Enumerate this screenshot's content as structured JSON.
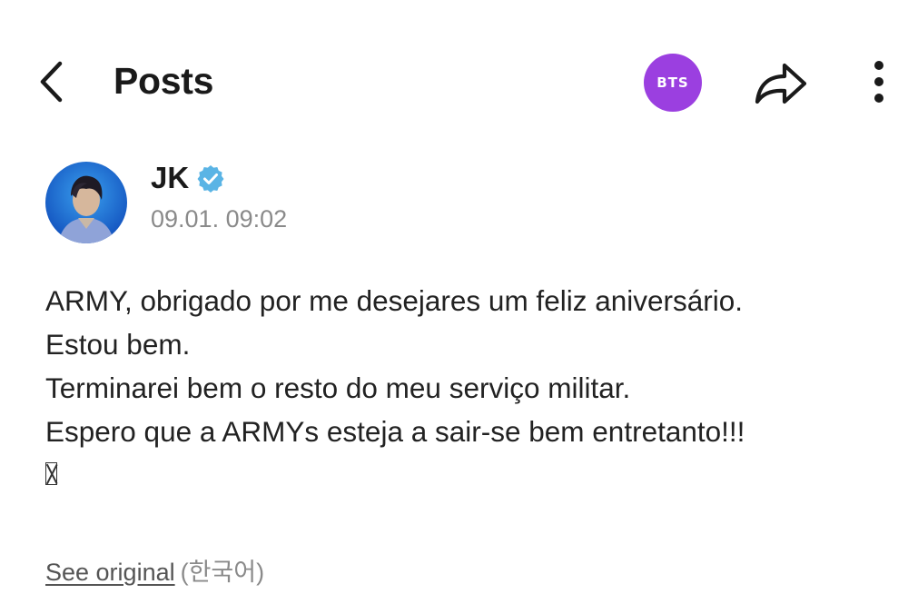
{
  "header": {
    "title": "Posts",
    "community_badge": "BTS",
    "accent_color": "#9b3fe0",
    "icons": [
      "back-arrow-icon",
      "share-icon",
      "more-vertical-icon"
    ]
  },
  "post": {
    "author": "JK",
    "verified": true,
    "verified_color": "#5ab4e5",
    "timestamp": "09.01. 09:02",
    "lines": [
      "ARMY, obrigado por me desejares um feliz aniversário.",
      "Estou bem.",
      "Terminarei bem o resto do meu serviço militar.",
      "Espero que a ARMYs esteja a sair-se bem entretanto!!!"
    ],
    "see_original_label": "See original",
    "original_language": "(한국어)"
  }
}
